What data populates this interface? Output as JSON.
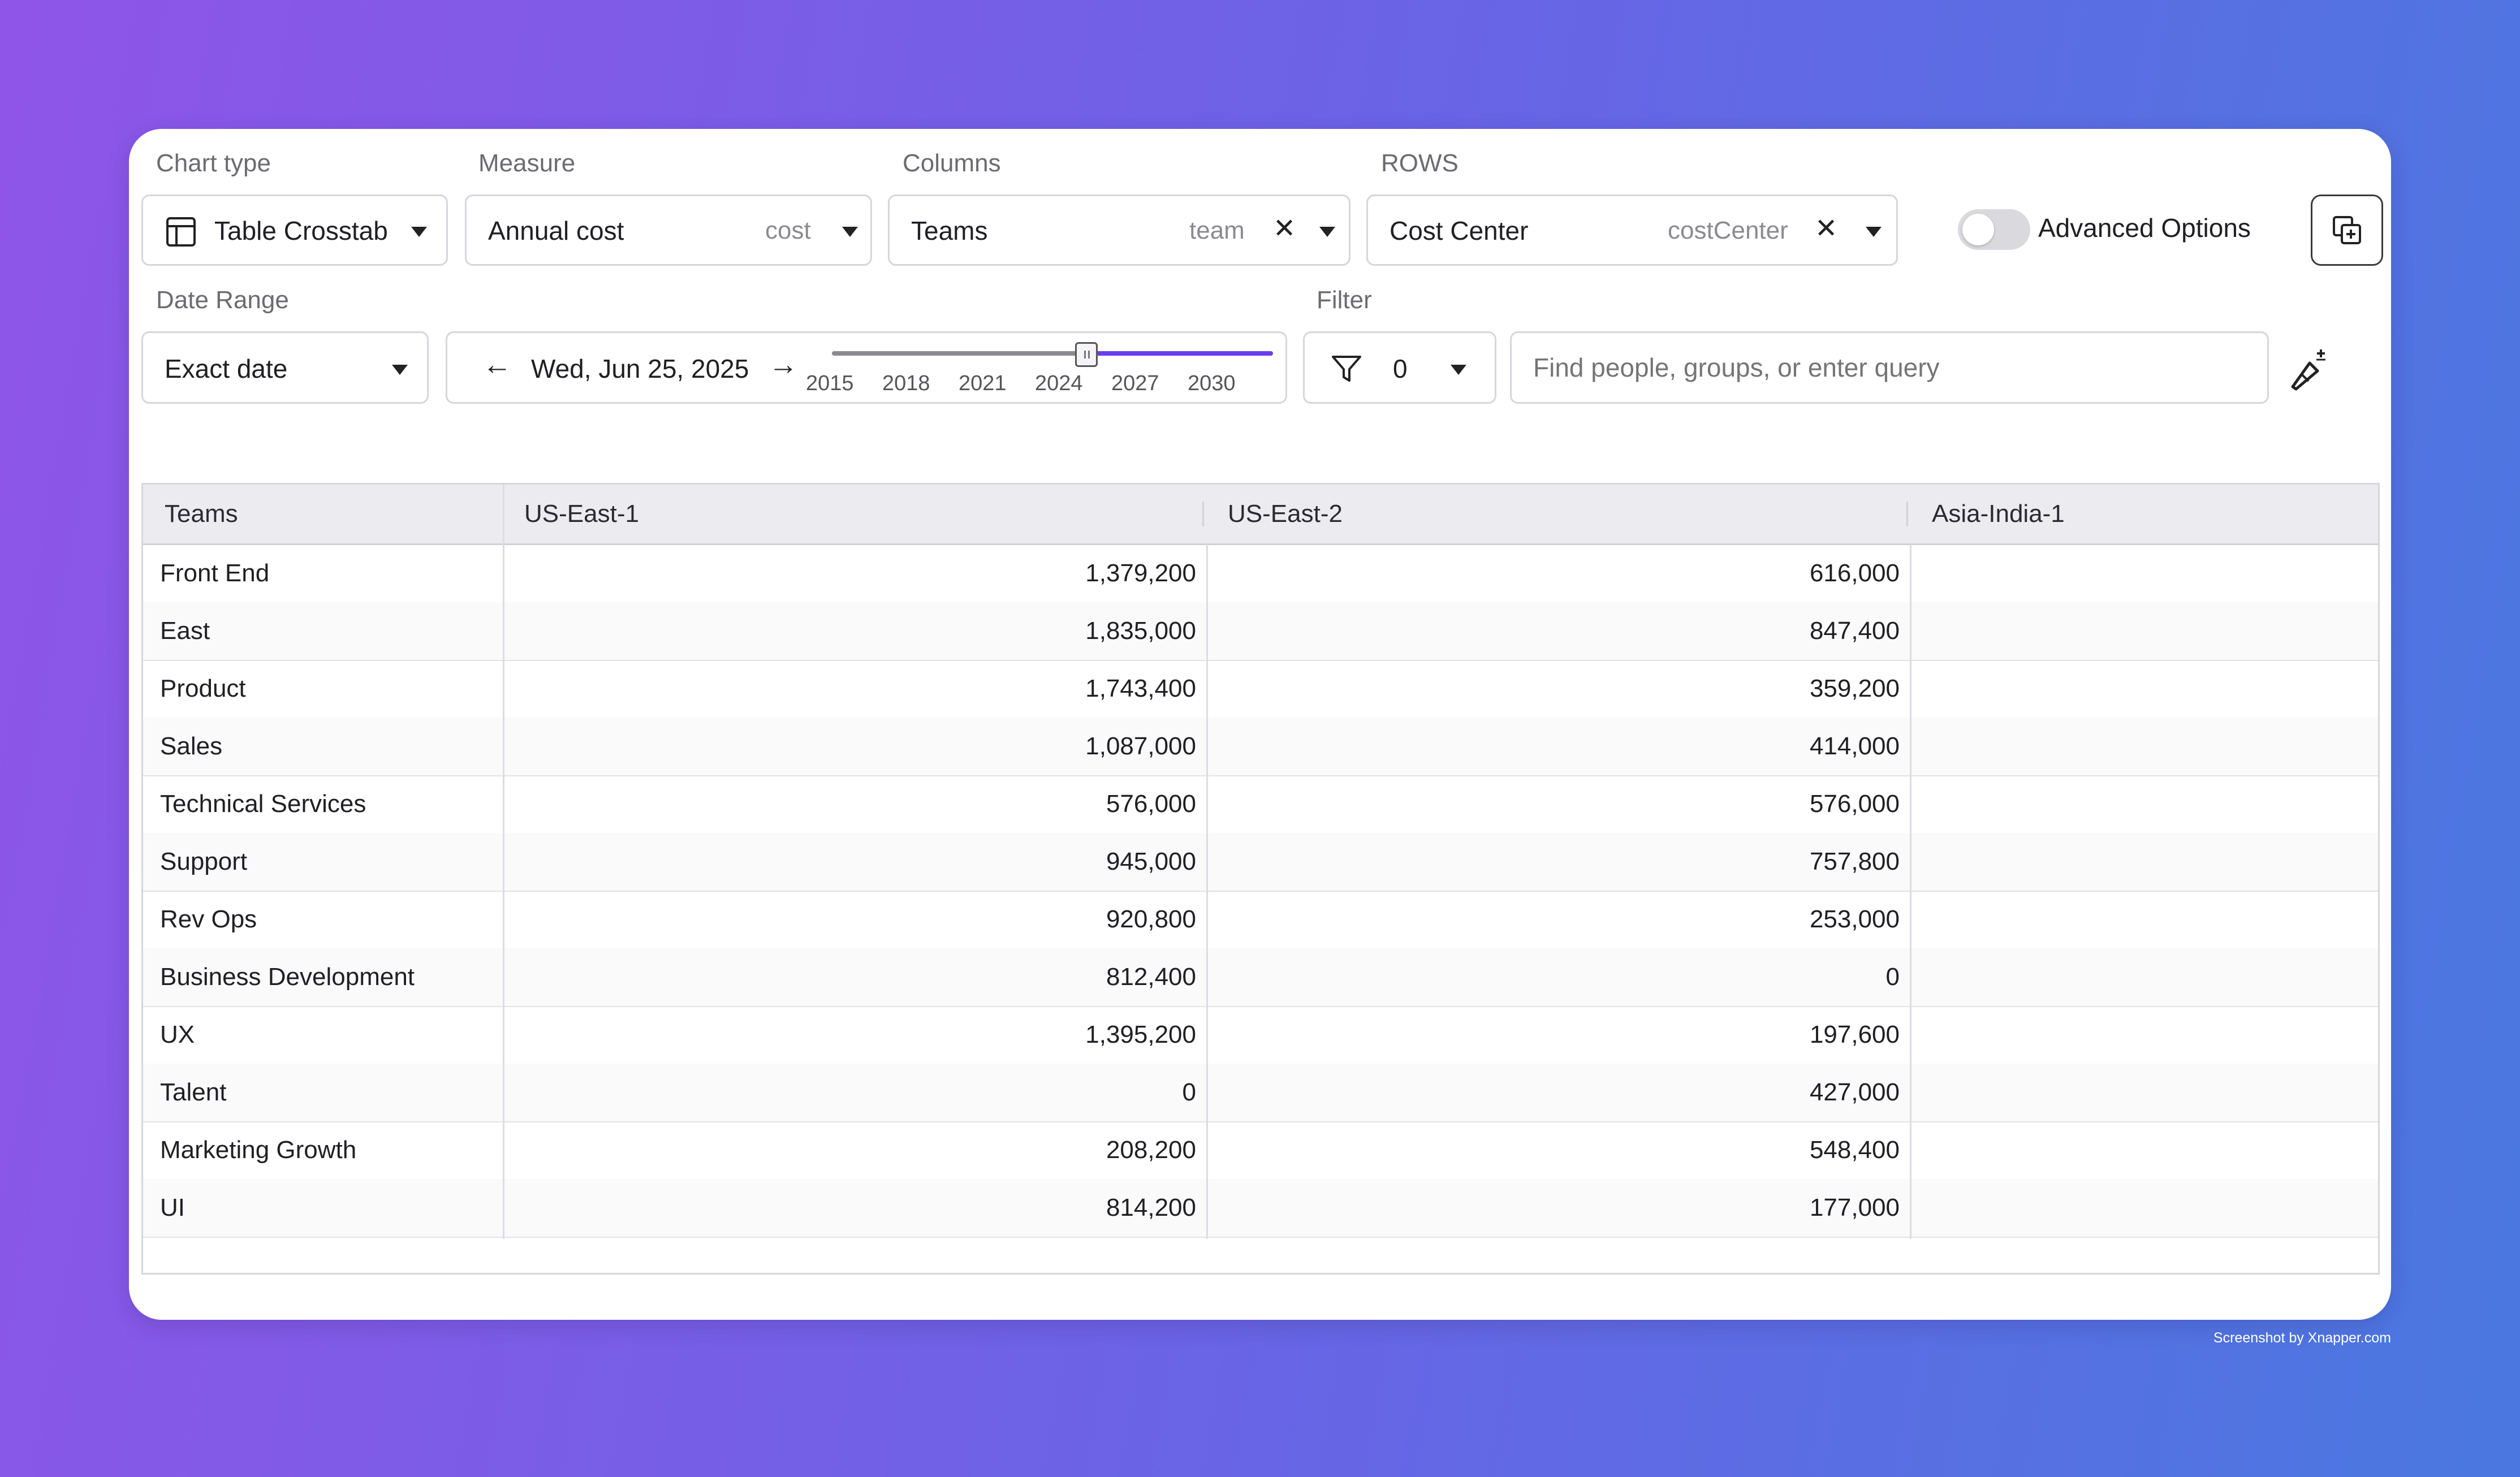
{
  "controls": {
    "chart_type": {
      "label": "Chart type",
      "value": "Table Crosstab"
    },
    "measure": {
      "label": "Measure",
      "value": "Annual cost",
      "hint": "cost"
    },
    "columns": {
      "label": "Columns",
      "value": "Teams",
      "hint": "team"
    },
    "rows": {
      "label": "ROWS",
      "value": "Cost Center",
      "hint": "costCenter"
    },
    "advanced_options": {
      "label": "Advanced Options",
      "enabled": false
    },
    "date_range": {
      "label": "Date Range",
      "value": "Exact date"
    },
    "date_nav": {
      "date": "Wed, Jun 25, 2025"
    },
    "slider": {
      "ticks": [
        "2015",
        "2018",
        "2021",
        "2024",
        "2027",
        "2030"
      ],
      "min": 2015,
      "max": 2030,
      "value": 2025
    },
    "filter": {
      "label": "Filter",
      "count": "0"
    },
    "search": {
      "placeholder": "Find people, groups, or enter query"
    }
  },
  "table": {
    "headers": [
      "Teams",
      "US-East-1",
      "US-East-2",
      "Asia-India-1"
    ],
    "rows": [
      [
        "Front End",
        "1,379,200",
        "616,000",
        ""
      ],
      [
        "East",
        "1,835,000",
        "847,400",
        ""
      ],
      [
        "Product",
        "1,743,400",
        "359,200",
        ""
      ],
      [
        "Sales",
        "1,087,000",
        "414,000",
        ""
      ],
      [
        "Technical Services",
        "576,000",
        "576,000",
        ""
      ],
      [
        "Support",
        "945,000",
        "757,800",
        ""
      ],
      [
        "Rev Ops",
        "920,800",
        "253,000",
        ""
      ],
      [
        "Business Development",
        "812,400",
        "0",
        ""
      ],
      [
        "UX",
        "1,395,200",
        "197,600",
        ""
      ],
      [
        "Talent",
        "0",
        "427,000",
        ""
      ],
      [
        "Marketing Growth",
        "208,200",
        "548,400",
        ""
      ],
      [
        "UI",
        "814,200",
        "177,000",
        ""
      ]
    ]
  },
  "footer": {
    "credit": "Screenshot by Xnapper.com"
  },
  "colors": {
    "accent": "#6a3df0",
    "background_start": "#8f55e8",
    "background_end": "#4a78e0"
  }
}
